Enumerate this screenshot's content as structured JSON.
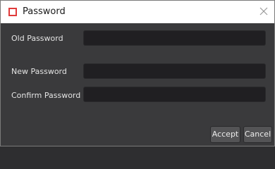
{
  "window": {
    "title": "Password",
    "icon": "app-icon-red-square",
    "close_icon": "close-icon"
  },
  "form": {
    "old_password_label": "Old Password",
    "new_password_label": "New Password",
    "confirm_password_label": "Confirm Password",
    "old_password_value": "",
    "new_password_value": "",
    "confirm_password_value": ""
  },
  "buttons": {
    "accept_label": "Accept",
    "cancel_label": "Cancel"
  },
  "colors": {
    "accent_icon": "#e03a3a",
    "background": "#3a3a3c",
    "field_background": "#201f22"
  }
}
